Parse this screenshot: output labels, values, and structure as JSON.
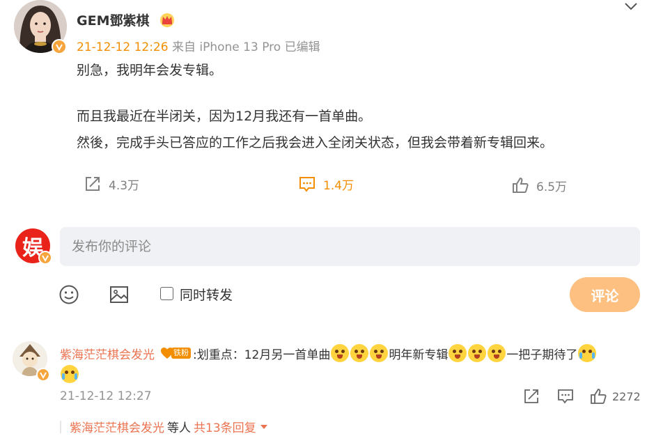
{
  "post": {
    "author": "GEM鄧紫棋",
    "time": "21-12-12 12:26",
    "source": "来自 iPhone 13 Pro",
    "edited": "已编辑",
    "lines": [
      "别急，我明年会发专辑。",
      "而且我最近在半闭关，因为12月我还有一首单曲。",
      "然後，完成手头已答应的工作之后我会进入全闭关状态，但我会带着新专辑回来。"
    ],
    "actions": {
      "repost_count": "4.3万",
      "comment_count": "1.4万",
      "like_count": "6.5万"
    }
  },
  "composer": {
    "avatar_char": "娱",
    "placeholder": "发布你的评论",
    "repost_label": "同时转发",
    "submit_label": "评论"
  },
  "comment": {
    "user": "紫海茫茫棋会发光",
    "fan_level": "铁粉",
    "text_parts": {
      "prefix": ":划重点：12月另一首单曲",
      "middle": "明年新专辑",
      "suffix": "一把子期待了"
    },
    "time": "21-12-12 12:27",
    "like_count": "2272",
    "replies": {
      "user": "紫海茫茫棋会发光",
      "others": "等人",
      "count_text": "共13条回复"
    }
  },
  "icons": {
    "verified": "verified-v-icon",
    "crown": "crown-icon",
    "chevron": "chevron-down-icon",
    "repost": "repost-icon",
    "comment": "comment-icon",
    "like": "like-icon",
    "emoji": "emoji-icon",
    "image": "image-icon"
  },
  "colors": {
    "accent": "#f28e00",
    "username": "#eb7350",
    "muted": "#939393",
    "submit_disabled": "#fdc080",
    "input_bg": "#f0f1f4"
  }
}
